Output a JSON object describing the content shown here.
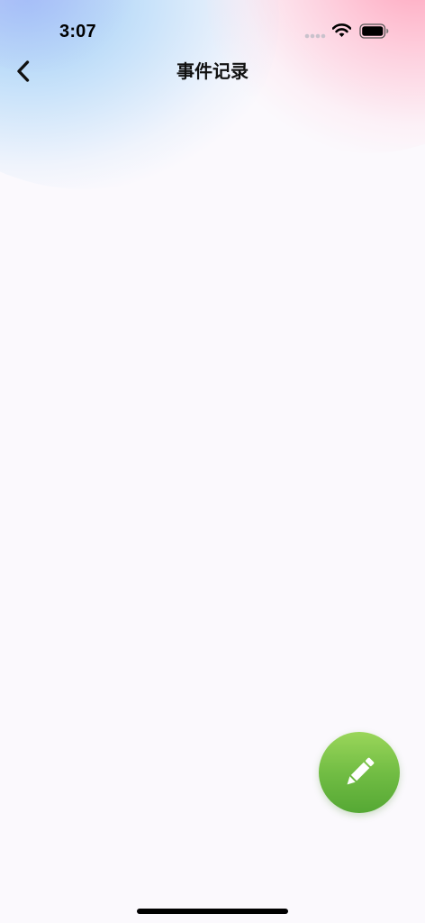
{
  "status_bar": {
    "time": "3:07",
    "signal_icon": "signal-dots-icon",
    "wifi_icon": "wifi-icon",
    "battery_icon": "battery-icon"
  },
  "nav": {
    "title": "事件记录",
    "back_icon": "chevron-left-icon"
  },
  "fab": {
    "icon": "pencil-icon"
  },
  "colors": {
    "background": "#fbf9fd",
    "fab_top": "#9ad65a",
    "fab_bottom": "#55a834",
    "glow_blue": "#96c8f5",
    "glow_pink": "#ffa0b9"
  }
}
